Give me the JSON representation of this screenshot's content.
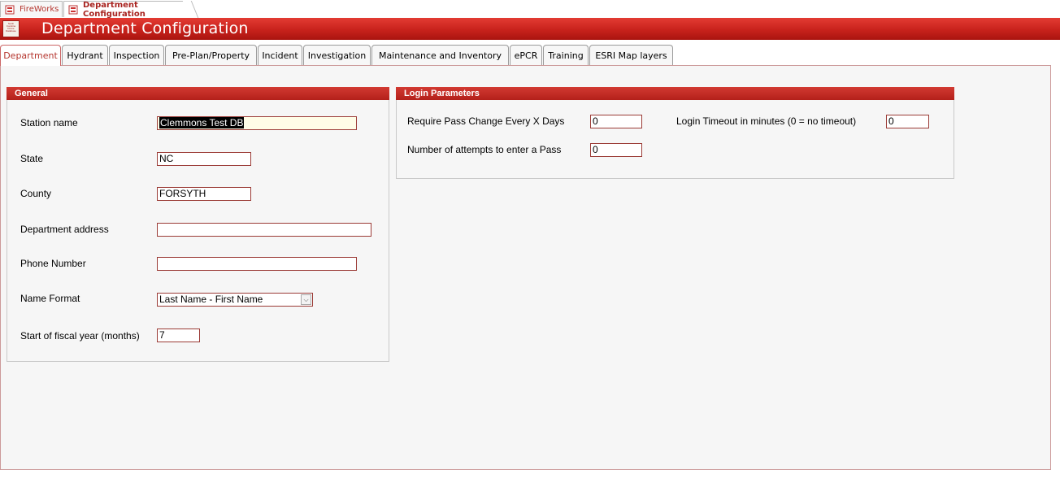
{
  "doc_tabs": [
    {
      "label": "FireWorks"
    },
    {
      "label": "Department Configuration"
    }
  ],
  "header": {
    "logo_text": "North Carolina Drone Database",
    "title": "Department Configuration"
  },
  "tabs": [
    {
      "label": "Department",
      "active": true
    },
    {
      "label": "Hydrant"
    },
    {
      "label": "Inspection"
    },
    {
      "label": "Pre-Plan/Property"
    },
    {
      "label": "Incident"
    },
    {
      "label": "Investigation"
    },
    {
      "label": "Maintenance and Inventory"
    },
    {
      "label": "ePCR"
    },
    {
      "label": "Training"
    },
    {
      "label": "ESRI Map layers"
    }
  ],
  "general": {
    "title": "General",
    "station_name": {
      "label": "Station name",
      "value": "Clemmons Test DB"
    },
    "state": {
      "label": "State",
      "value": "NC"
    },
    "county": {
      "label": "County",
      "value": "FORSYTH"
    },
    "address": {
      "label": "Department address",
      "value": ""
    },
    "phone": {
      "label": "Phone Number",
      "value": ""
    },
    "name_format": {
      "label": "Name Format",
      "value": "Last Name - First Name"
    },
    "fiscal_start": {
      "label": "Start of fiscal year (months)",
      "value": "7"
    }
  },
  "login": {
    "title": "Login Parameters",
    "pass_change": {
      "label": "Require Pass Change Every X Days",
      "value": "0"
    },
    "attempts": {
      "label": "Number of attempts to enter a Pass",
      "value": "0"
    },
    "timeout": {
      "label": "Login Timeout in minutes (0 = no timeout)",
      "value": "0"
    }
  }
}
